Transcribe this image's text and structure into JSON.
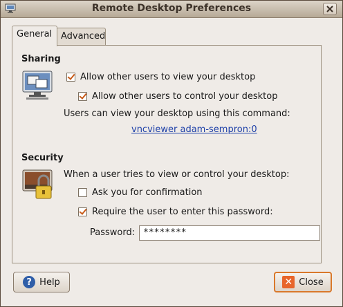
{
  "window": {
    "title": "Remote Desktop Preferences"
  },
  "tabs": [
    {
      "label": "General",
      "selected": true
    },
    {
      "label": "Advanced",
      "selected": false
    }
  ],
  "sharing": {
    "title": "Sharing",
    "allow_view": {
      "label": "Allow other users to view your desktop",
      "checked": true
    },
    "allow_control": {
      "label": "Allow other users to control your desktop",
      "checked": true
    },
    "command_hint": "Users can view your desktop using this command:",
    "command_link": "vncviewer adam-sempron:0"
  },
  "security": {
    "title": "Security",
    "hint": "When a user tries to view or control your desktop:",
    "ask_confirm": {
      "label": "Ask you for confirmation",
      "checked": false
    },
    "require_password": {
      "label": "Require the user to enter this password:",
      "checked": true
    },
    "password_label": "Password:",
    "password_value": "********"
  },
  "buttons": {
    "help_label": "Help",
    "close_label": "Close"
  },
  "colors": {
    "accent": "#d9782a",
    "link": "#1c3fa8",
    "titlebar": "#b6a996"
  },
  "icons": {
    "title": "remote-desktop-icon",
    "sharing": "desktop-sharing-icon",
    "security": "lock-screen-icon",
    "help": "help-icon",
    "close": "close-icon"
  }
}
